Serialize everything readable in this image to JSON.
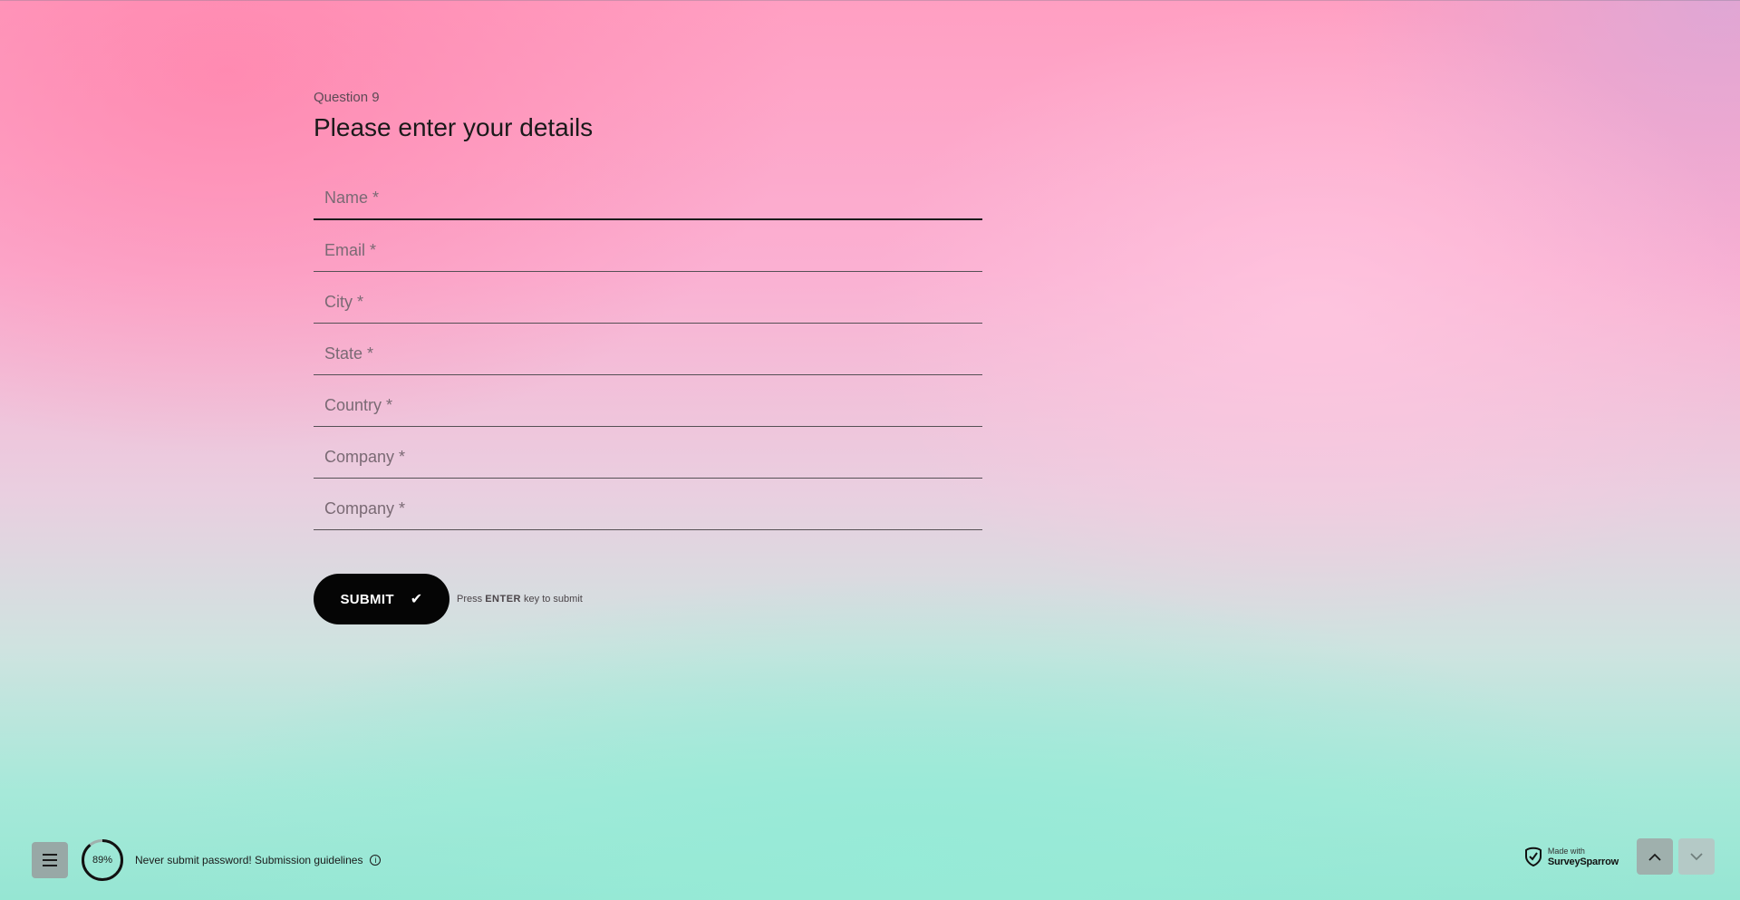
{
  "question": {
    "number_label": "Question 9",
    "title": "Please enter your details"
  },
  "fields": [
    {
      "placeholder": "Name *",
      "value": ""
    },
    {
      "placeholder": "Email *",
      "value": ""
    },
    {
      "placeholder": "City *",
      "value": ""
    },
    {
      "placeholder": "State *",
      "value": ""
    },
    {
      "placeholder": "Country *",
      "value": ""
    },
    {
      "placeholder": "Company *",
      "value": ""
    },
    {
      "placeholder": "Company *",
      "value": ""
    }
  ],
  "submit": {
    "label": "SUBMIT",
    "hint_prefix": "Press",
    "hint_key": "ENTER",
    "hint_suffix": "key to submit"
  },
  "footer": {
    "progress_percent": 89,
    "progress_label": "89%",
    "notice": "Never submit password! Submission guidelines",
    "brand_small": "Made with",
    "brand_name": "SurveySparrow",
    "icons": {
      "menu": "menu-icon",
      "info": "info-icon",
      "up": "chevron-up-icon",
      "down": "chevron-down-icon",
      "check": "check-icon"
    }
  },
  "colors": {
    "accent": "#050505",
    "progress_track": "#9fb0ad",
    "progress_fill": "#111111"
  }
}
